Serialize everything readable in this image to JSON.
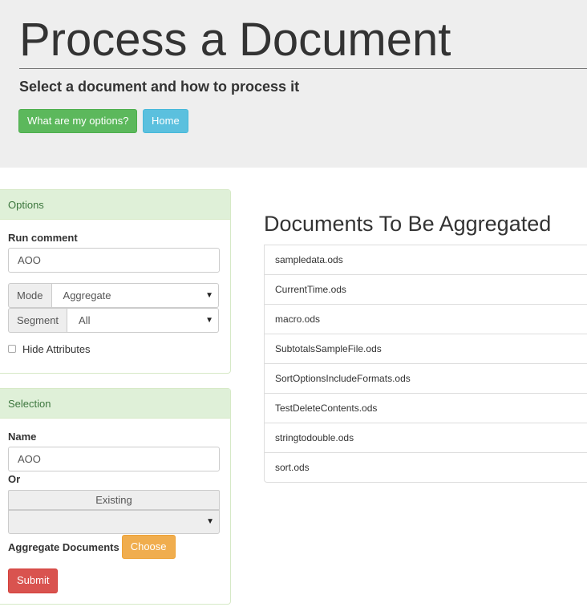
{
  "header": {
    "title": "Process a Document",
    "subtitle": "Select a document and how to process it",
    "options_button": "What are my options?",
    "home_button": "Home"
  },
  "options_panel": {
    "heading": "Options",
    "run_comment_label": "Run comment",
    "run_comment_value": "AOO",
    "mode_label": "Mode",
    "mode_value": "Aggregate",
    "segment_label": "Segment",
    "segment_value": "All",
    "hide_attributes_label": "Hide Attributes",
    "hide_attributes_checked": false
  },
  "selection_panel": {
    "heading": "Selection",
    "name_label": "Name",
    "name_value": "AOO",
    "or_label": "Or",
    "existing_label": "Existing",
    "existing_value": "",
    "aggregate_label": "Aggregate Documents",
    "choose_button": "Choose",
    "submit_button": "Submit"
  },
  "documents": {
    "title": "Documents To Be Aggregated",
    "items": [
      "sampledata.ods",
      "CurrentTime.ods",
      "macro.ods",
      "SubtotalsSampleFile.ods",
      "SortOptionsIncludeFormats.ods",
      "TestDeleteContents.ods",
      "stringtodouble.ods",
      "sort.ods"
    ]
  },
  "colors": {
    "success": "#5cb85c",
    "info": "#5bc0de",
    "warning": "#f0ad4e",
    "danger": "#d9534f",
    "panel_heading": "#dff0d8",
    "jumbotron": "#eeeeee"
  }
}
